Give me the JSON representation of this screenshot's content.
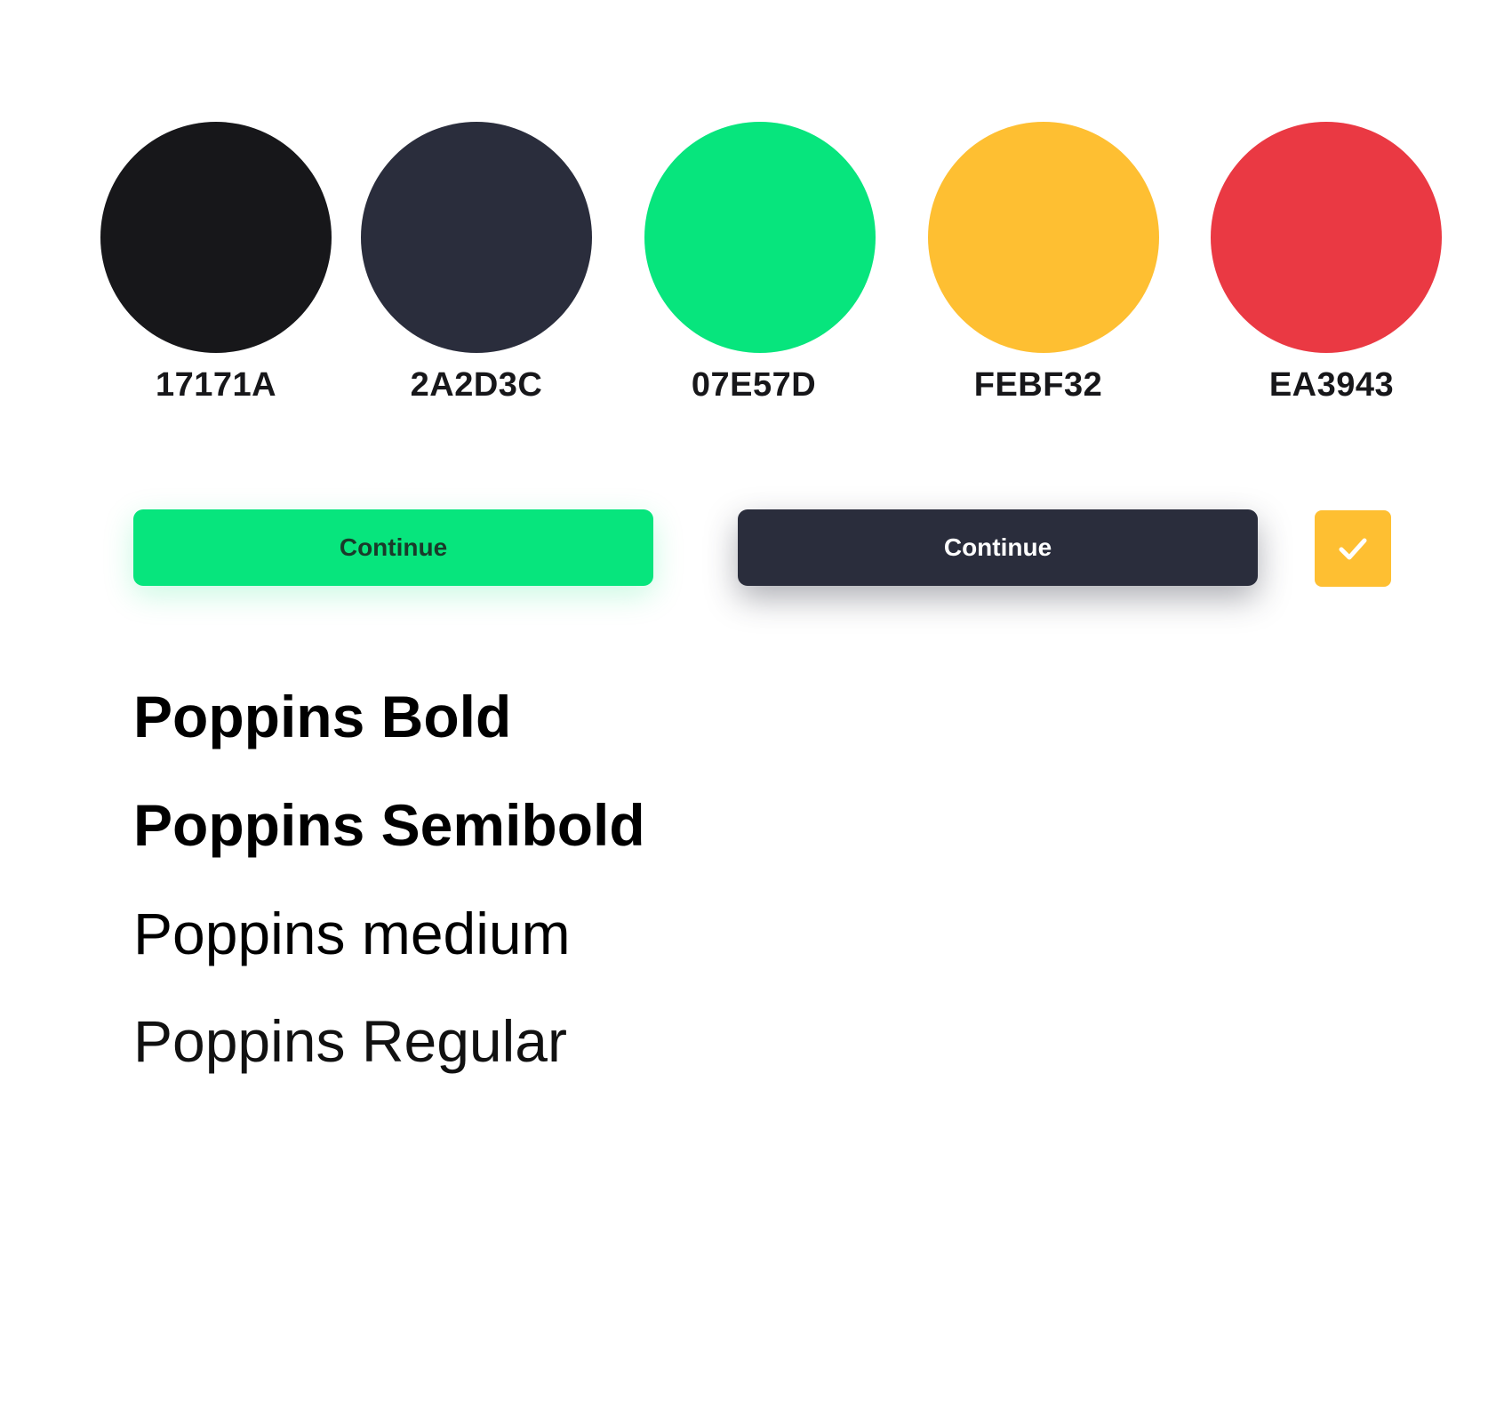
{
  "palette": {
    "swatches": [
      {
        "label": "17171A",
        "color": "#17171A"
      },
      {
        "label": "2A2D3C",
        "color": "#2A2D3C"
      },
      {
        "label": "07E57D",
        "color": "#07E57D"
      },
      {
        "label": "FEBF32",
        "color": "#FEBF32"
      },
      {
        "label": "EA3943",
        "color": "#EA3943"
      }
    ]
  },
  "buttons": {
    "primary_label": "Continue",
    "primary_color": "#07E57D",
    "secondary_label": "Continue",
    "secondary_color": "#2A2D3C"
  },
  "checkbox": {
    "checked": true,
    "color": "#FEBF32",
    "icon": "checkmark-icon"
  },
  "typography": {
    "samples": [
      "Poppins Bold",
      "Poppins Semibold",
      "Poppins medium",
      "Poppins Regular"
    ]
  }
}
